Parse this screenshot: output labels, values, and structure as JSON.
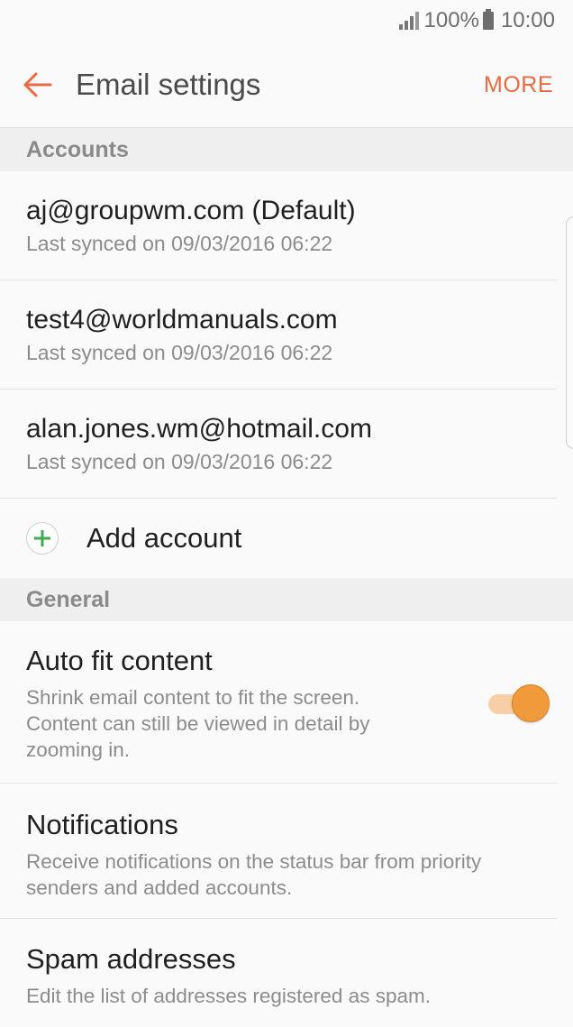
{
  "status_bar": {
    "battery_text": "100%",
    "time": "10:00",
    "signal_icon": "signal-icon",
    "battery_icon": "battery-icon"
  },
  "app_bar": {
    "title": "Email settings",
    "more_label": "MORE",
    "back_icon": "arrow-left-icon",
    "accent_color": "#e86a45"
  },
  "sections": {
    "accounts_header": "Accounts",
    "general_header": "General"
  },
  "accounts": [
    {
      "email": "aj@groupwm.com (Default)",
      "sync": "Last synced on 09/03/2016 06:22"
    },
    {
      "email": "test4@worldmanuals.com",
      "sync": "Last synced on 09/03/2016 06:22"
    },
    {
      "email": "alan.jones.wm@hotmail.com",
      "sync": "Last synced on 09/03/2016 06:22"
    }
  ],
  "add_account": {
    "label": "Add account",
    "icon": "plus-circle-icon"
  },
  "general": {
    "auto_fit": {
      "title": "Auto fit content",
      "desc": "Shrink email content to fit the screen. Content can still be viewed in detail by zooming in.",
      "toggle_on": true
    },
    "notifications": {
      "title": "Notifications",
      "desc": "Receive notifications on the status bar from priority senders and added accounts."
    },
    "spam": {
      "title": "Spam addresses",
      "desc": "Edit the list of addresses registered as spam."
    }
  }
}
